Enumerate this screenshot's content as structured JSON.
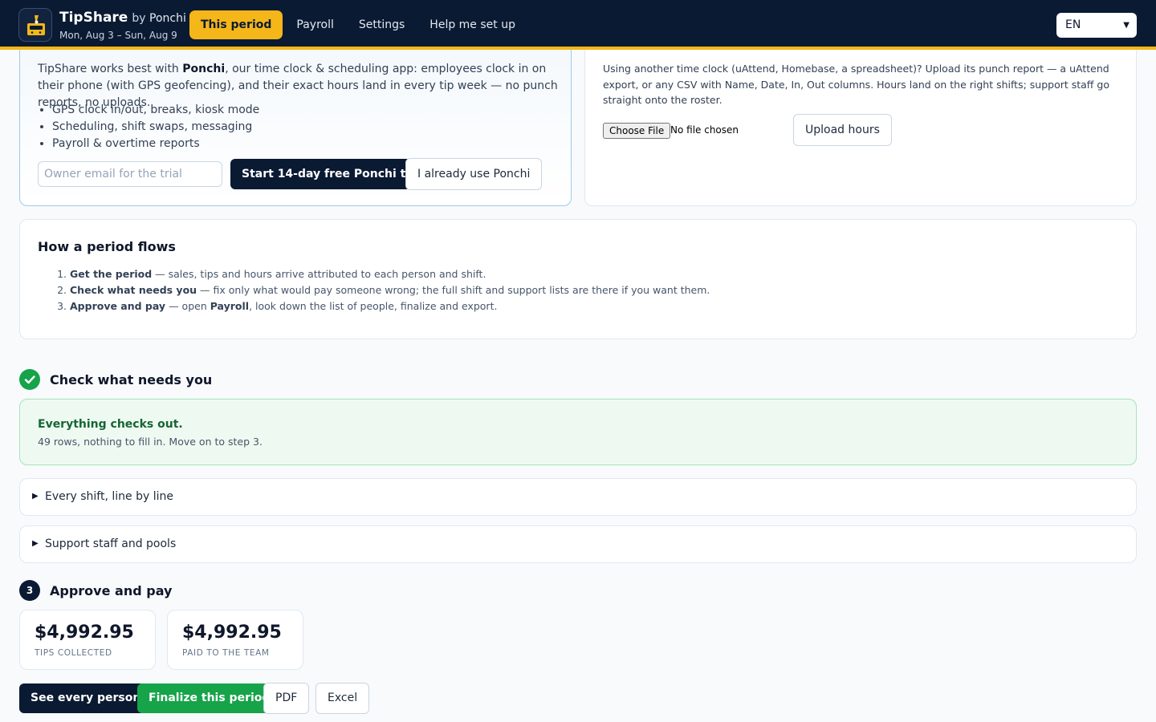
{
  "header": {
    "app_name": "TipShare",
    "by_prefix": "by",
    "by_brand": "Ponchi",
    "period": "Mon, Aug 3 – Sun, Aug 9",
    "nav": [
      "This period",
      "Payroll",
      "Settings",
      "Help me set up"
    ],
    "active_nav": "This period",
    "language": "EN"
  },
  "ponchi": {
    "intro_pre": "TipShare works best with ",
    "intro_brand": "Ponchi",
    "intro_post": ", our time clock & scheduling app: employees clock in on their phone (with GPS geofencing), and their exact hours land in every tip week — no punch reports, no uploads.",
    "features": [
      "GPS clock in/out, breaks, kiosk mode",
      "Scheduling, shift swaps, messaging",
      "Payroll & overtime reports"
    ],
    "email_placeholder": "Owner email for the trial",
    "trial_button": "Start 14-day free Ponchi trial",
    "existing_button": "I already use Ponchi"
  },
  "upload": {
    "description": "Using another time clock (uAttend, Homebase, a spreadsheet)? Upload its punch report — a uAttend export, or any CSV with Name, Date, In, Out columns. Hours land on the right shifts; support staff go straight onto the roster.",
    "choose_file": "Choose File",
    "no_file": "No file chosen",
    "upload_button": "Upload hours"
  },
  "flow": {
    "title": "How a period flows",
    "steps": [
      {
        "label": "Get the period",
        "text": " — sales, tips and hours arrive attributed to each person and shift."
      },
      {
        "label": "Check what needs you",
        "text": " — fix only what would pay someone wrong; the full shift and support lists are there if you want them."
      },
      {
        "label": "Approve and pay",
        "text_pre": " — open ",
        "bold": "Payroll",
        "text_post": ", look down the list of people, finalize and export."
      }
    ]
  },
  "check": {
    "title": "Check what needs you",
    "status_title": "Everything checks out.",
    "status_sub": "49 rows, nothing to fill in. Move on to step 3.",
    "sections": [
      "Every shift, line by line",
      "Support staff and pools"
    ]
  },
  "approve": {
    "step_number": "3",
    "title": "Approve and pay",
    "stats": [
      {
        "value": "$4,992.95",
        "label": "TIPS COLLECTED"
      },
      {
        "value": "$4,992.95",
        "label": "PAID TO THE TEAM"
      }
    ],
    "buttons": [
      "See every person",
      "Finalize this period",
      "PDF",
      "Excel"
    ]
  },
  "colors": {
    "navy": "#0b1a33",
    "accent_yellow": "#f4b619",
    "success_green": "#16a34a",
    "ponchi_border": "#9fcbe8"
  },
  "icons": [
    "tip-jar-logo-icon",
    "chevron-down-icon",
    "checkmark-icon",
    "disclosure-triangle-icon"
  ]
}
